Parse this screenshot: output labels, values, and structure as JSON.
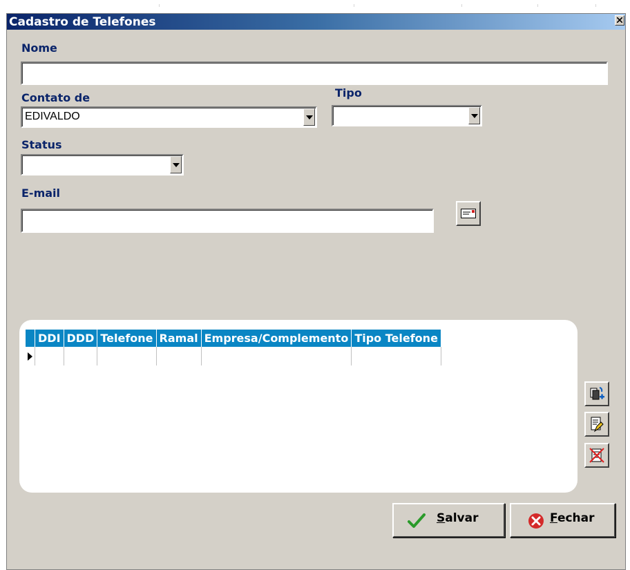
{
  "window": {
    "title": "Cadastro de Telefones"
  },
  "form": {
    "nome": {
      "label": "Nome",
      "value": ""
    },
    "contato": {
      "label": "Contato de",
      "value": "EDIVALDO"
    },
    "tipo": {
      "label": "Tipo",
      "value": ""
    },
    "status": {
      "label": "Status",
      "value": ""
    },
    "email": {
      "label": "E-mail",
      "value": ""
    }
  },
  "grid": {
    "columns": [
      "DDI",
      "DDD",
      "Telefone",
      "Ramal",
      "Empresa/Complemento",
      "Tipo Telefone"
    ]
  },
  "actions": {
    "add_icon": "add-phone-icon",
    "edit_icon": "edit-phone-icon",
    "delete_icon": "delete-phone-icon"
  },
  "footer": {
    "salvar": {
      "first": "S",
      "rest": "alvar"
    },
    "fechar": {
      "first": "F",
      "rest": "echar"
    }
  },
  "colors": {
    "title_start": "#0a246a",
    "grid_header": "#0a86c4",
    "label": "#0a246a",
    "face": "#d4d0c8"
  }
}
